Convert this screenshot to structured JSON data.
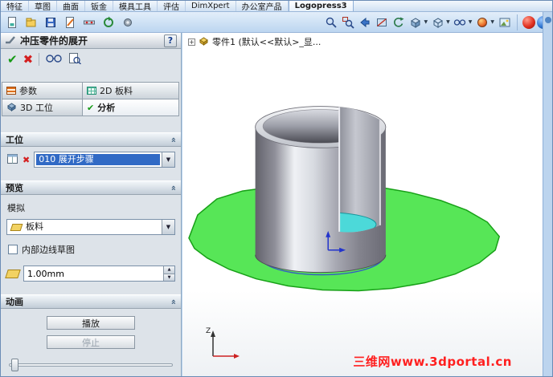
{
  "menubar": {
    "items": [
      "特征",
      "草图",
      "曲面",
      "钣金",
      "模具工具",
      "评估",
      "DimXpert",
      "办公室产品",
      "Logopress3"
    ]
  },
  "panel": {
    "title": "冲压零件的展开",
    "help_label": "?",
    "tabs": [
      {
        "label": "参数"
      },
      {
        "label": "2D 板料"
      },
      {
        "label": "3D 工位"
      },
      {
        "label": "分析"
      }
    ],
    "station": {
      "title": "工位",
      "step_value": "010 展开步骤"
    },
    "preview": {
      "title": "预览",
      "simulate_label": "模拟",
      "blank_value": "板料",
      "inner_edge_checkbox": "内部边线草图",
      "thickness_value": "1.00mm"
    },
    "animation": {
      "title": "动画",
      "play_label": "播放",
      "stop_label": "停止"
    }
  },
  "viewport": {
    "tree_item": "零件1 (默认<<默认>_显...",
    "triad_z_label": "Z",
    "watermark": "三维网www.3dportal.cn"
  },
  "icons": {
    "ok": "✔",
    "cancel": "✖",
    "dropdown": "▼",
    "section_collapse": "»",
    "spin_up": "▲",
    "spin_down": "▼",
    "expand_plus": "+"
  },
  "colors": {
    "blank_green": "#57e657",
    "floor_cyan": "#4cd9d9",
    "sketch_blue": "#3556c8",
    "watermark_red": "#ff1f1f",
    "selection_blue": "#316ac5"
  }
}
